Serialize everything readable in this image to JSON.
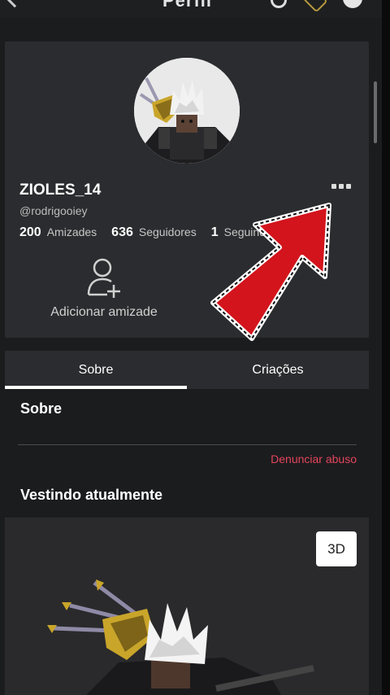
{
  "header": {
    "title": "Perfil"
  },
  "profile": {
    "display_name": "ZIOLES_14",
    "username": "@rodrigooiey",
    "stats": [
      {
        "value": "200",
        "label": "Amizades"
      },
      {
        "value": "636",
        "label": "Seguidores"
      },
      {
        "value": "1",
        "label": "Seguindo"
      }
    ],
    "add_friend_label": "Adicionar amizade"
  },
  "tabs": [
    {
      "label": "Sobre",
      "active": true
    },
    {
      "label": "Criações",
      "active": false
    }
  ],
  "about": {
    "title": "Sobre",
    "report_label": "Denunciar abuso"
  },
  "wearing": {
    "title": "Vestindo atualmente",
    "view_3d_label": "3D"
  },
  "colors": {
    "background": "#1b1c1e",
    "card": "#2b2c2f",
    "report": "#e3455c",
    "arrow": "#d3141c"
  }
}
